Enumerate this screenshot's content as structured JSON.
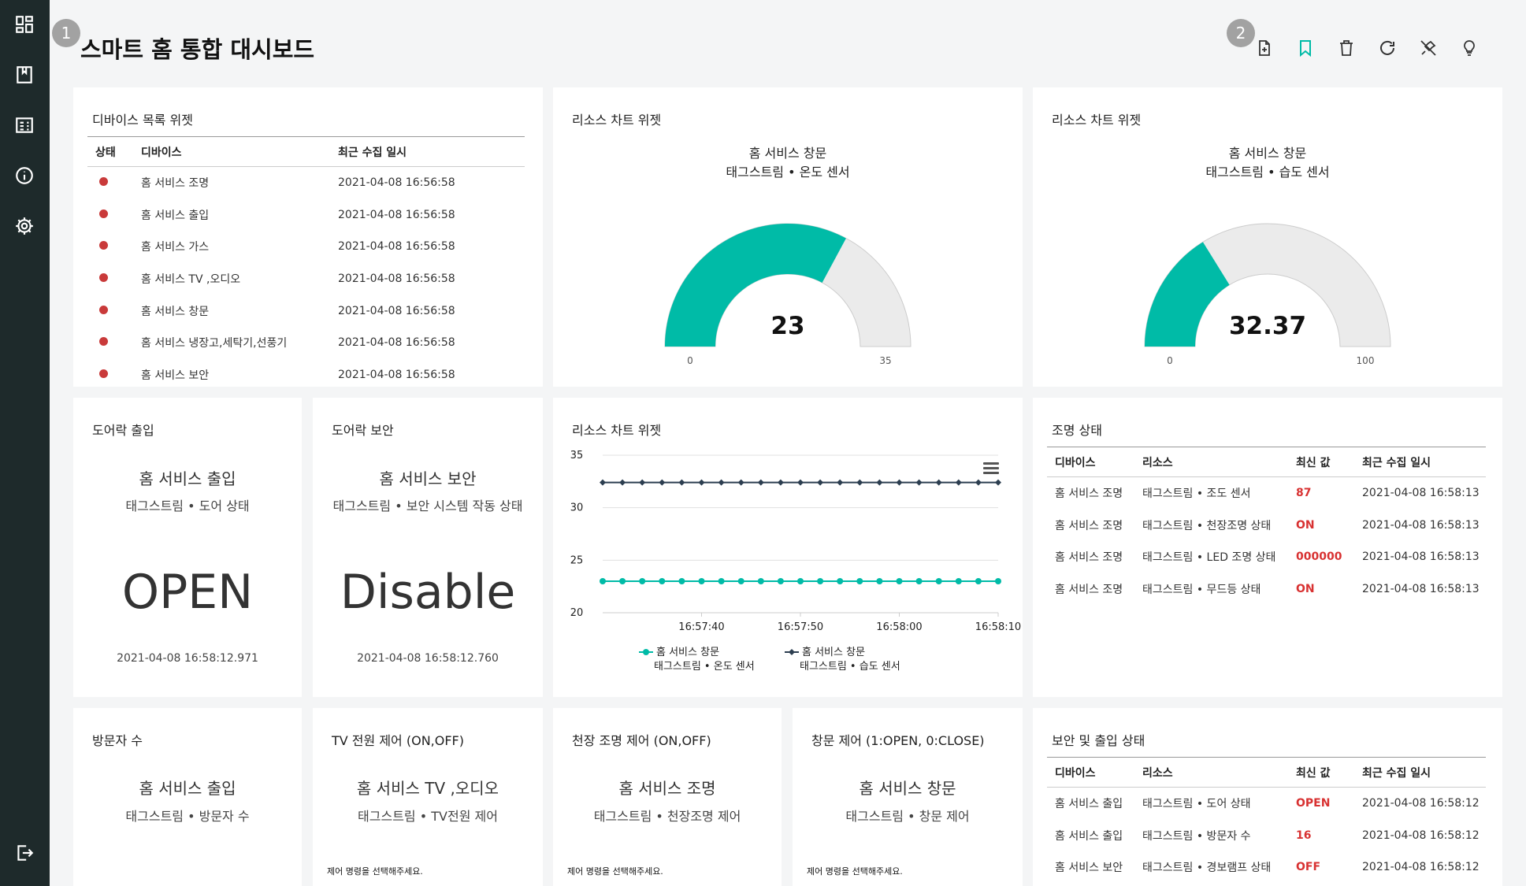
{
  "page": {
    "title": "스마트 홈 통합 대시보드"
  },
  "markers": {
    "one": "1",
    "two": "2"
  },
  "colors": {
    "accent": "#00bba7",
    "sidebar": "#1e2a2b",
    "status_dot": "#c93a3a",
    "value_red": "#d83232",
    "gauge_empty": "#ebebeb"
  },
  "sidebar": {
    "items": [
      {
        "icon": "dashboard-grid-icon"
      },
      {
        "icon": "book-icon"
      },
      {
        "icon": "report-icon"
      },
      {
        "icon": "info-icon"
      },
      {
        "icon": "gear-icon"
      }
    ],
    "bottom": {
      "icon": "logout-icon"
    }
  },
  "toolbar": {
    "tools": [
      "add-file-icon",
      "bookmark-icon",
      "trash-icon",
      "refresh-icon",
      "unpin-icon",
      "lightbulb-icon"
    ]
  },
  "device_list": {
    "title": "디바이스 목록 위젯",
    "headers": [
      "상태",
      "디바이스",
      "최근 수집 일시"
    ],
    "rows": [
      {
        "device": "홈 서비스 조명",
        "time": "2021-04-08 16:56:58"
      },
      {
        "device": "홈 서비스 출입",
        "time": "2021-04-08 16:56:58"
      },
      {
        "device": "홈 서비스 가스",
        "time": "2021-04-08 16:56:58"
      },
      {
        "device": "홈 서비스 TV ,오디오",
        "time": "2021-04-08 16:56:58"
      },
      {
        "device": "홈 서비스 창문",
        "time": "2021-04-08 16:56:58"
      },
      {
        "device": "홈 서비스 냉장고,세탁기,선풍기",
        "time": "2021-04-08 16:56:58"
      },
      {
        "device": "홈 서비스 보안",
        "time": "2021-04-08 16:56:58"
      }
    ]
  },
  "gauge1": {
    "title": "리소스 차트 위젯",
    "line1": "홈 서비스 창문",
    "line2": "태그스트림 • 온도 센서",
    "value": 23,
    "value_label": "23",
    "min": 0,
    "max": 35,
    "min_label": "0",
    "max_label": "35"
  },
  "gauge2": {
    "title": "리소스 차트 위젯",
    "line1": "홈 서비스 창문",
    "line2": "태그스트림 • 습도 센서",
    "value": 32.37,
    "value_label": "32.37",
    "min": 0,
    "max": 100,
    "min_label": "0",
    "max_label": "100"
  },
  "door_access": {
    "title": "도어락 출입",
    "resource": "홈 서비스 출입",
    "sub": "태그스트림 • 도어 상태",
    "value": "OPEN",
    "time": "2021-04-08 16:58:12.971"
  },
  "door_security": {
    "title": "도어락 보안",
    "resource": "홈 서비스 보안",
    "sub": "태그스트림 • 보안 시스템 작동 상태",
    "value": "Disable",
    "time": "2021-04-08 16:58:12.760"
  },
  "line_chart": {
    "title": "리소스 차트 위젯"
  },
  "chart_data": {
    "type": "line",
    "x": [
      "16:57:30",
      "16:57:32",
      "16:57:34",
      "16:57:36",
      "16:57:38",
      "16:57:40",
      "16:57:42",
      "16:57:44",
      "16:57:46",
      "16:57:48",
      "16:57:50",
      "16:57:52",
      "16:57:54",
      "16:57:56",
      "16:57:58",
      "16:58:00",
      "16:58:02",
      "16:58:04",
      "16:58:06",
      "16:58:08",
      "16:58:10"
    ],
    "xticks": [
      "16:57:40",
      "16:57:50",
      "16:58:00",
      "16:58:10"
    ],
    "yticks": [
      "35",
      "30",
      "25",
      "20"
    ],
    "ylim": [
      20,
      35
    ],
    "series": [
      {
        "name": "홈 서비스 창문",
        "name2": "태그스트림 • 온도 센서",
        "color": "#00bba7",
        "marker": "circle",
        "values": [
          23,
          23,
          23,
          23,
          23,
          23,
          23,
          23,
          23,
          23,
          23,
          23,
          23,
          23,
          23,
          23,
          23,
          23,
          23,
          23,
          23
        ]
      },
      {
        "name": "홈 서비스 창문",
        "name2": "태그스트림 • 습도 센서",
        "color": "#2c3e50",
        "marker": "diamond",
        "values": [
          32.4,
          32.4,
          32.4,
          32.4,
          32.4,
          32.4,
          32.4,
          32.4,
          32.4,
          32.4,
          32.4,
          32.4,
          32.4,
          32.4,
          32.4,
          32.4,
          32.4,
          32.4,
          32.4,
          32.4,
          32.4
        ]
      }
    ],
    "legend": "bottom"
  },
  "lighting": {
    "title": "조명 상태",
    "headers": [
      "디바이스",
      "리소스",
      "최신 값",
      "최근 수집 일시"
    ],
    "rows": [
      {
        "device": "홈 서비스 조명",
        "resource": "태그스트림 • 조도 센서",
        "value": "87",
        "time": "2021-04-08 16:58:13"
      },
      {
        "device": "홈 서비스 조명",
        "resource": "태그스트림 • 천장조명 상태",
        "value": "ON",
        "time": "2021-04-08 16:58:13"
      },
      {
        "device": "홈 서비스 조명",
        "resource": "태그스트림 • LED 조명 상태",
        "value": "000000",
        "time": "2021-04-08 16:58:13"
      },
      {
        "device": "홈 서비스 조명",
        "resource": "태그스트림 • 무드등 상태",
        "value": "ON",
        "time": "2021-04-08 16:58:13"
      }
    ]
  },
  "visitors": {
    "title": "방문자 수",
    "resource": "홈 서비스 출입",
    "sub": "태그스트림 • 방문자 수"
  },
  "tv_power": {
    "title": "TV 전원 제어 (ON,OFF)",
    "resource": "홈 서비스 TV ,오디오",
    "sub": "태그스트림 • TV전원 제어",
    "hint": "제어 명령을 선택해주세요."
  },
  "ceiling_light": {
    "title": "천장 조명 제어 (ON,OFF)",
    "resource": "홈 서비스 조명",
    "sub": "태그스트림 • 천장조명 제어",
    "hint": "제어 명령을 선택해주세요."
  },
  "window_ctrl": {
    "title": "창문 제어 (1:OPEN, 0:CLOSE)",
    "resource": "홈 서비스 창문",
    "sub": "태그스트림 • 창문 제어",
    "hint": "제어 명령을 선택해주세요."
  },
  "security": {
    "title": "보안 및 출입 상태",
    "headers": [
      "디바이스",
      "리소스",
      "최신 값",
      "최근 수집 일시"
    ],
    "rows": [
      {
        "device": "홈 서비스 출입",
        "resource": "태그스트림 • 도어 상태",
        "value": "OPEN",
        "time": "2021-04-08 16:58:12"
      },
      {
        "device": "홈 서비스 출입",
        "resource": "태그스트림 • 방문자 수",
        "value": "16",
        "time": "2021-04-08 16:58:12"
      },
      {
        "device": "홈 서비스 보안",
        "resource": "태그스트림 • 경보램프 상태",
        "value": "OFF",
        "time": "2021-04-08 16:58:12"
      }
    ]
  }
}
